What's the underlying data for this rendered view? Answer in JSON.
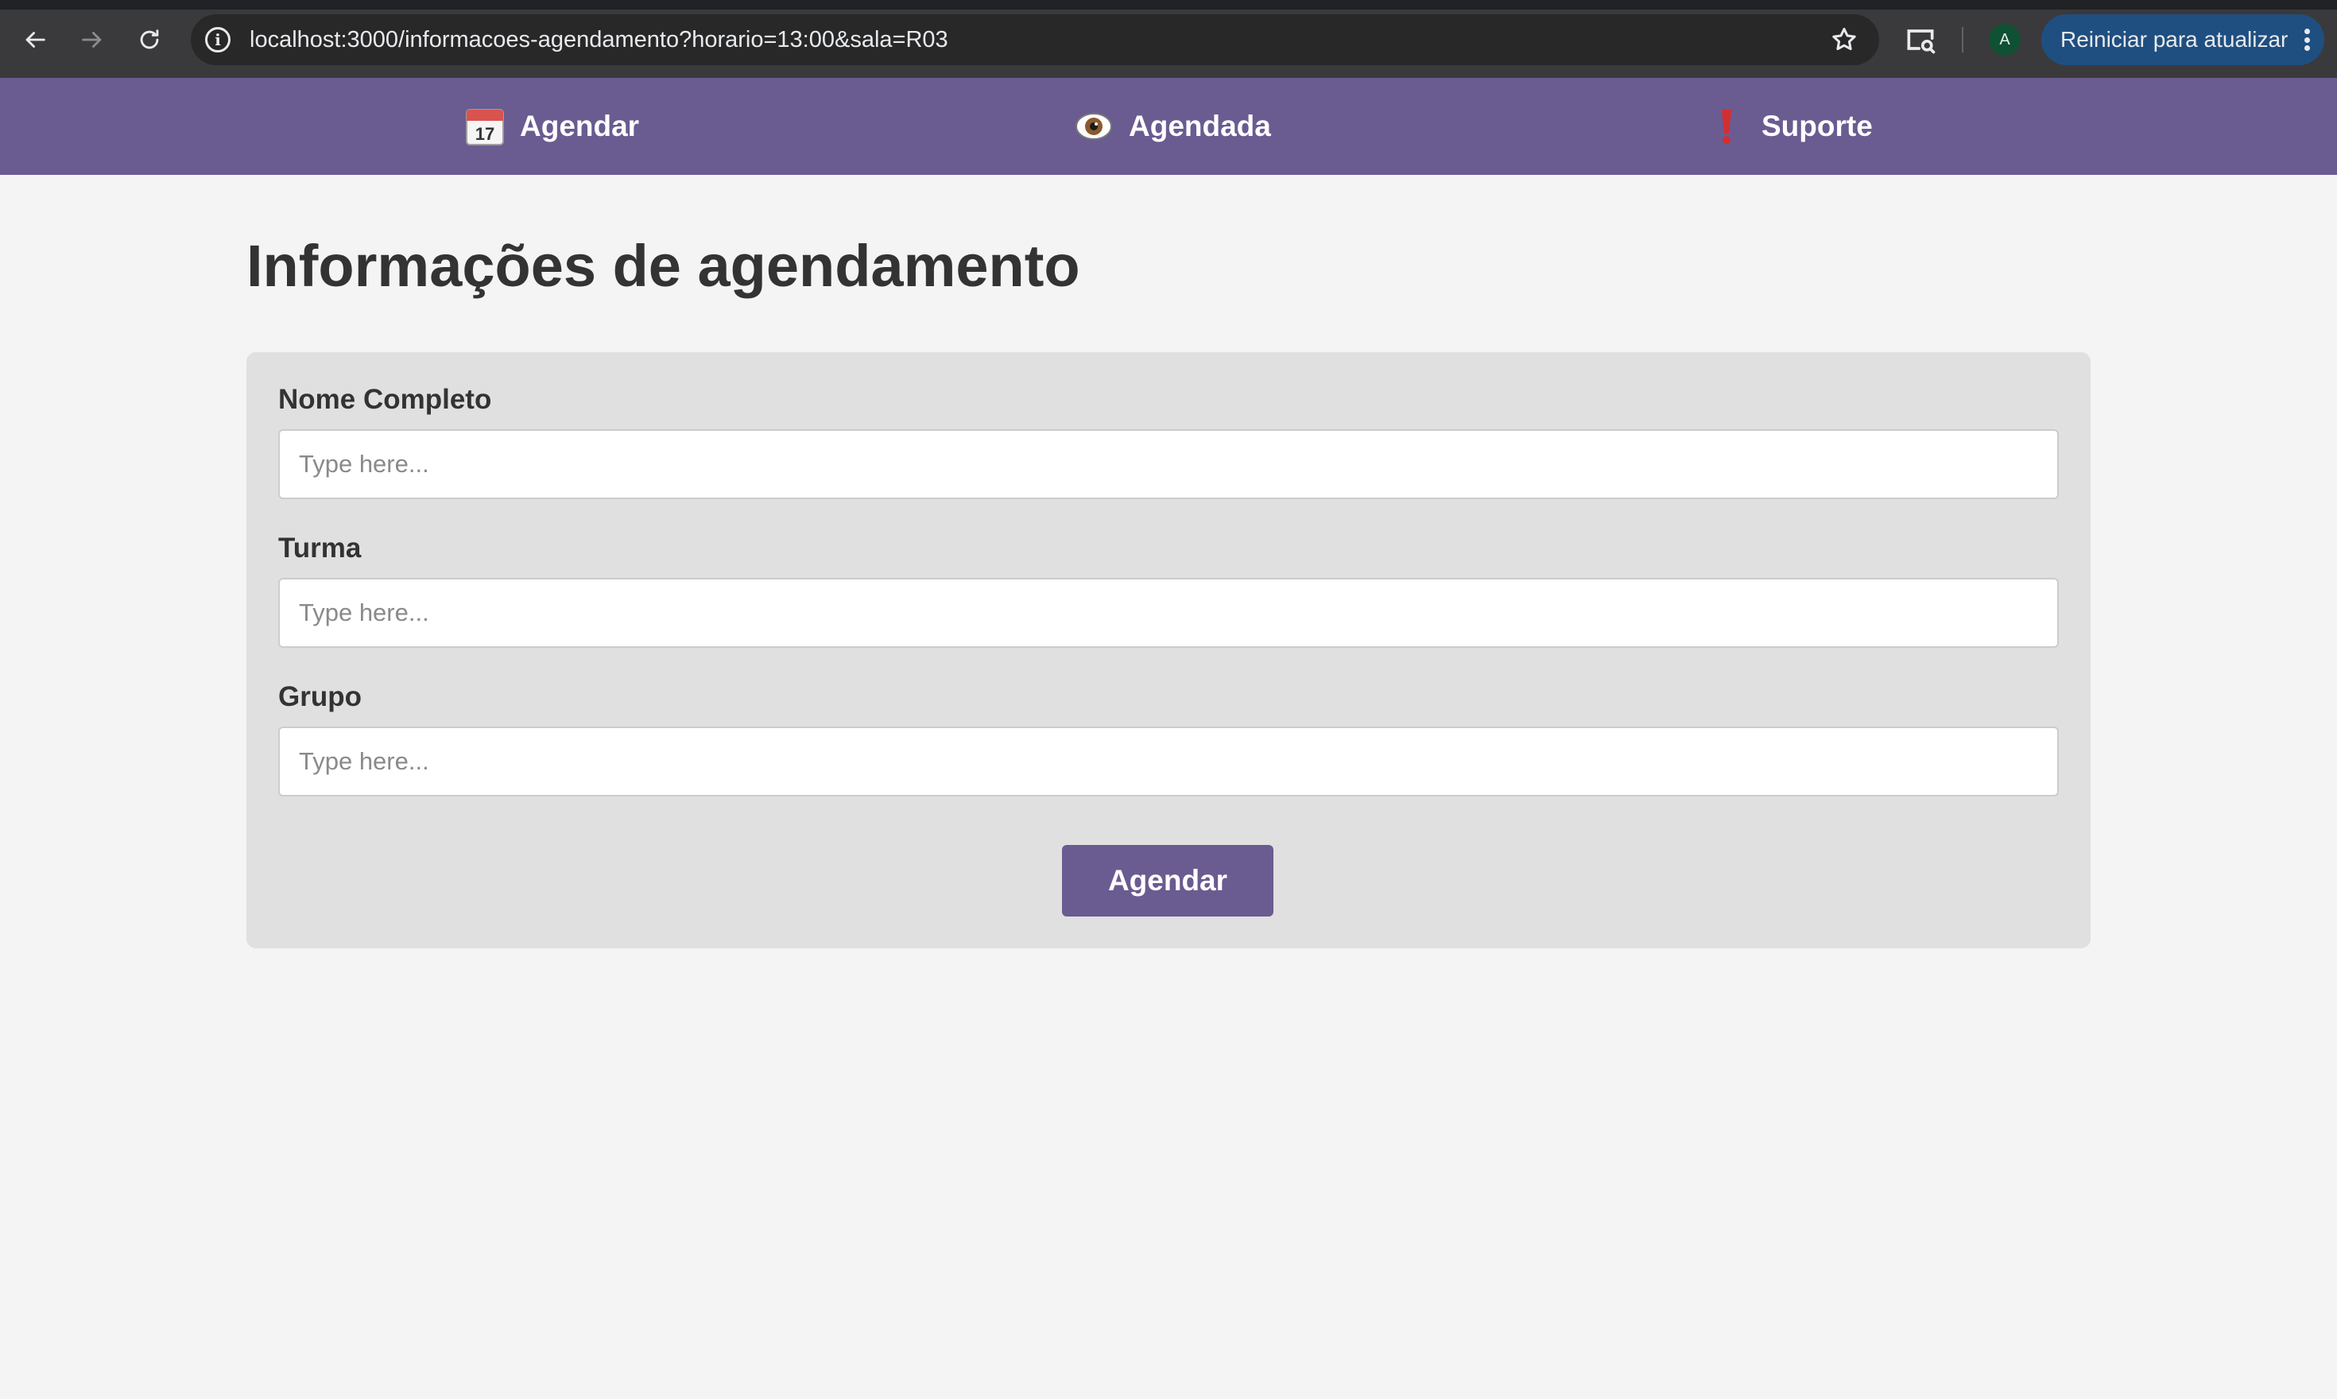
{
  "browser": {
    "url": "localhost:3000/informacoes-agendamento?horario=13:00&sala=R03",
    "profile_initial": "A",
    "update_button_label": "Reiniciar para atualizar"
  },
  "navbar": {
    "items": [
      {
        "label": "Agendar",
        "icon": "calendar-icon"
      },
      {
        "label": "Agendada",
        "icon": "eye-icon"
      },
      {
        "label": "Suporte",
        "icon": "exclamation-icon"
      }
    ],
    "background": "#6a5b91"
  },
  "page": {
    "title": "Informações de agendamento"
  },
  "form": {
    "fields": [
      {
        "label": "Nome Completo",
        "placeholder": "Type here...",
        "value": ""
      },
      {
        "label": "Turma",
        "placeholder": "Type here...",
        "value": ""
      },
      {
        "label": "Grupo",
        "placeholder": "Type here...",
        "value": ""
      }
    ],
    "submit_label": "Agendar"
  },
  "colors": {
    "accent": "#6a5b91",
    "card": "#e0e0e0",
    "page_background": "#f4f4f4"
  }
}
